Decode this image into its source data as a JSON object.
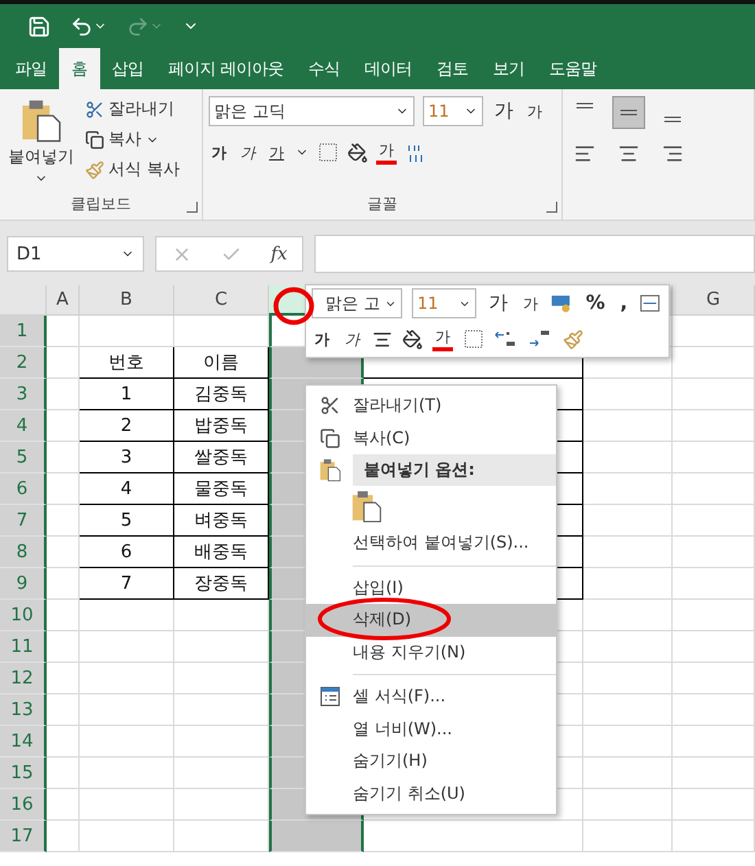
{
  "tabs": [
    {
      "label": "파일",
      "selected": false
    },
    {
      "label": "홈",
      "selected": true
    },
    {
      "label": "삽입",
      "selected": false
    },
    {
      "label": "페이지 레이아웃",
      "selected": false
    },
    {
      "label": "수식",
      "selected": false
    },
    {
      "label": "데이터",
      "selected": false
    },
    {
      "label": "검토",
      "selected": false
    },
    {
      "label": "보기",
      "selected": false
    },
    {
      "label": "도움말",
      "selected": false
    }
  ],
  "clipboard": {
    "label": "클립보드",
    "paste": "붙여넣기",
    "cut": "잘라내기",
    "copy": "복사",
    "format_painter": "서식 복사"
  },
  "font": {
    "label": "글꼴",
    "font_name": "맑은 고딕",
    "font_size": "11",
    "grow": "가",
    "shrink": "가",
    "bold": "가",
    "italic": "가",
    "underline": "가",
    "font_color": "가"
  },
  "alignment": [
    {
      "kind": "top",
      "selected": false
    },
    {
      "kind": "middle",
      "selected": true
    },
    {
      "kind": "bottom",
      "selected": false
    },
    {
      "kind": "left",
      "selected": false
    },
    {
      "kind": "center",
      "selected": false
    },
    {
      "kind": "right",
      "selected": false
    }
  ],
  "formula_bar": {
    "name_box": "D1",
    "function_label": "fx"
  },
  "columns": [
    {
      "label": "A",
      "selected": false
    },
    {
      "label": "B",
      "selected": false
    },
    {
      "label": "C",
      "selected": false
    },
    {
      "selected": true
    },
    {
      "selected": false
    },
    {
      "selected": false
    },
    {
      "label": "G",
      "selected": false
    }
  ],
  "rows": [
    {
      "number": "1"
    },
    {
      "number": "2",
      "b": "번호",
      "c": "이름"
    },
    {
      "number": "3",
      "b": "1",
      "c": "김중독"
    },
    {
      "number": "4",
      "b": "2",
      "c": "밥중독"
    },
    {
      "number": "5",
      "b": "3",
      "c": "쌀중독"
    },
    {
      "number": "6",
      "b": "4",
      "c": "물중독"
    },
    {
      "number": "7",
      "b": "5",
      "c": "벼중독"
    },
    {
      "number": "8",
      "b": "6",
      "c": "배중독"
    },
    {
      "number": "9",
      "b": "7",
      "c": "장중독"
    },
    {
      "number": "10"
    },
    {
      "number": "11"
    },
    {
      "number": "12"
    },
    {
      "number": "13"
    },
    {
      "number": "14"
    },
    {
      "number": "15"
    },
    {
      "number": "16"
    },
    {
      "number": "17"
    }
  ],
  "mini_toolbar": {
    "font_name": "맑은 고",
    "font_size": "11",
    "grow": "가",
    "shrink": "가",
    "percent": "%",
    "comma": ",",
    "bold": "가",
    "italic": "가",
    "font_color": "가"
  },
  "context_menu": [
    {
      "kind": "cut",
      "label": "잘라내기(T)",
      "selected": false
    },
    {
      "kind": "copy",
      "label": "복사(C)",
      "selected": false
    },
    {
      "kind": "header",
      "label": "붙여넣기 옵션:"
    },
    {
      "kind": "paste"
    },
    {
      "kind": "item",
      "label": "선택하여 붙여넣기(S)...",
      "selected": false
    },
    {
      "kind": "separator"
    },
    {
      "kind": "item",
      "label": "삽입(I)",
      "selected": false
    },
    {
      "kind": "item",
      "label": "삭제(D)",
      "selected": true
    },
    {
      "kind": "item",
      "label": "내용 지우기(N)",
      "selected": false
    },
    {
      "kind": "separator"
    },
    {
      "kind": "format",
      "label": "셀 서식(F)...",
      "selected": false
    },
    {
      "kind": "item",
      "label": "열 너비(W)...",
      "selected": false
    },
    {
      "kind": "item",
      "label": "숨기기(H)",
      "selected": false
    },
    {
      "kind": "item",
      "label": "숨기기 취소(U)",
      "selected": false
    }
  ]
}
